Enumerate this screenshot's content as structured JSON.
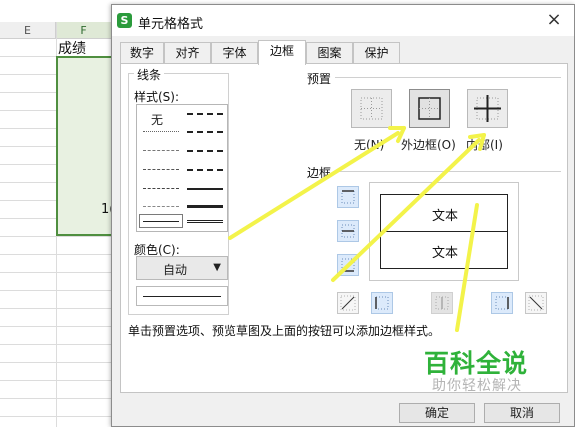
{
  "sheet": {
    "col_e": "E",
    "col_f": "F",
    "header_cell": "成绩",
    "partial_value": "1("
  },
  "dialog": {
    "title": "单元格格式",
    "close_glyph": "×",
    "tabs": [
      {
        "label": "数字"
      },
      {
        "label": "对齐"
      },
      {
        "label": "字体"
      },
      {
        "label": "边框"
      },
      {
        "label": "图案"
      },
      {
        "label": "保护"
      }
    ],
    "active_tab": "边框",
    "line_group": {
      "title": "线条",
      "style_label": "样式(S):",
      "none_label": "无",
      "color_label": "颜色(C):",
      "color_value": "自动",
      "dropdown_arrow": "▼"
    },
    "preset": {
      "title": "预置",
      "items": [
        {
          "label": "无(N)"
        },
        {
          "label": "外边框(O)"
        },
        {
          "label": "内部(I)"
        }
      ]
    },
    "border": {
      "title": "边框",
      "preview_text_1": "文本",
      "preview_text_2": "文本"
    },
    "hint": "单击预置选项、预览草图及上面的按钮可以添加边框样式。",
    "buttons": {
      "ok": "确定",
      "cancel": "取消"
    }
  },
  "watermark": {
    "brand": "百科全说",
    "slogan": "助你轻松解决"
  },
  "colors": {
    "accent_selection": "#4f8f3f",
    "annotation_arrow": "#f3f34a",
    "watermark_green": "#2fb23a"
  }
}
